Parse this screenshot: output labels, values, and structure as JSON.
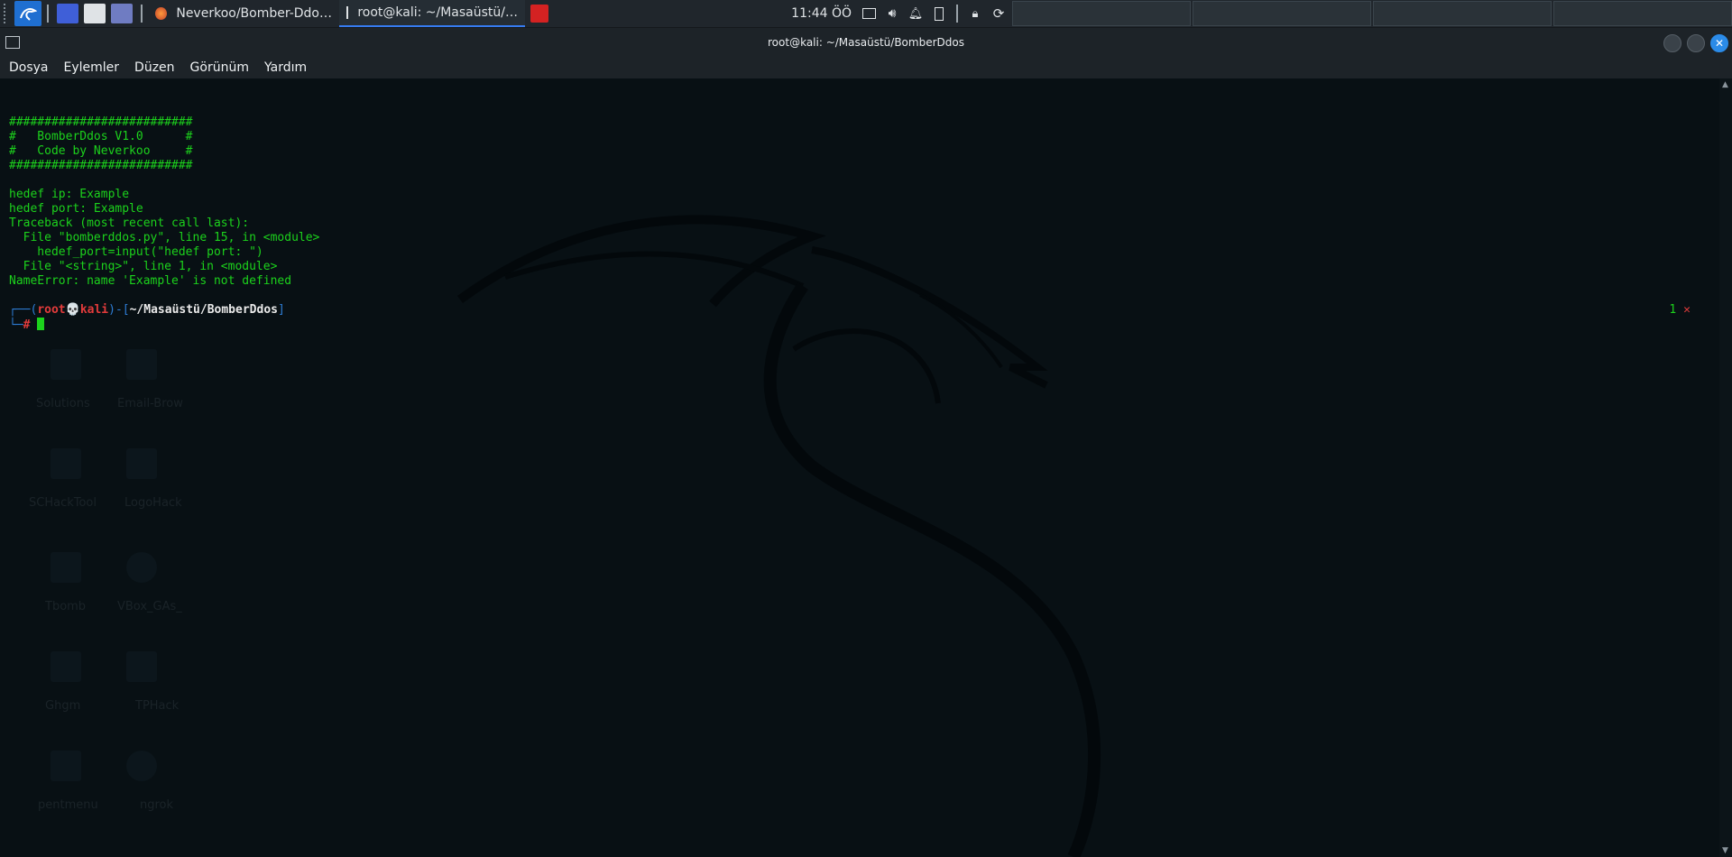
{
  "taskbar": {
    "tasks": [
      {
        "label": "Neverkoo/Bomber-Ddo…"
      },
      {
        "label": "root@kali: ~/Masaüstü/…"
      }
    ],
    "clock": "11:44 ÖÖ"
  },
  "window": {
    "title": "root@kali: ~/Masaüstü/BomberDdos"
  },
  "menu": {
    "items": [
      "Dosya",
      "Eylemler",
      "Düzen",
      "Görünüm",
      "Yardım"
    ]
  },
  "terminal": {
    "lines": [
      "##########################",
      "#   BomberDdos V1.0      #",
      "#   Code by Neverkoo     #",
      "##########################",
      "",
      "hedef ip: Example",
      "hedef port: Example",
      "Traceback (most recent call last):",
      "  File \"bomberddos.py\", line 15, in <module>",
      "    hedef_port=input(\"hedef port: \")",
      "  File \"<string>\", line 1, in <module>",
      "NameError: name 'Example' is not defined"
    ],
    "prompt": {
      "user": "root",
      "skull": "💀",
      "host": "kali",
      "path": "~/Masaüstü/BomberDdos",
      "hash": "#"
    },
    "status_code": "1",
    "status_mark": "✕"
  },
  "desktop_labels": [
    "Solutions",
    "Email-Brow",
    "SCHackTool",
    "LogoHack",
    "Tbomb",
    "VBox_GAs_",
    "Ghgm",
    "TPHack",
    "pentmenu",
    "ngrok"
  ]
}
